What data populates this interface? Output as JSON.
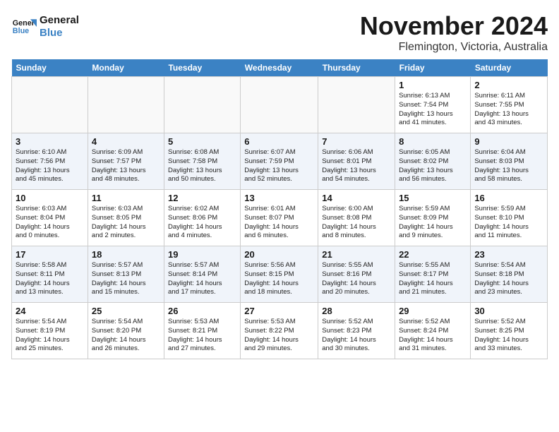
{
  "logo": {
    "line1": "General",
    "line2": "Blue"
  },
  "title": "November 2024",
  "location": "Flemington, Victoria, Australia",
  "headers": [
    "Sunday",
    "Monday",
    "Tuesday",
    "Wednesday",
    "Thursday",
    "Friday",
    "Saturday"
  ],
  "weeks": [
    [
      {
        "day": "",
        "info": ""
      },
      {
        "day": "",
        "info": ""
      },
      {
        "day": "",
        "info": ""
      },
      {
        "day": "",
        "info": ""
      },
      {
        "day": "",
        "info": ""
      },
      {
        "day": "1",
        "info": "Sunrise: 6:13 AM\nSunset: 7:54 PM\nDaylight: 13 hours\nand 41 minutes."
      },
      {
        "day": "2",
        "info": "Sunrise: 6:11 AM\nSunset: 7:55 PM\nDaylight: 13 hours\nand 43 minutes."
      }
    ],
    [
      {
        "day": "3",
        "info": "Sunrise: 6:10 AM\nSunset: 7:56 PM\nDaylight: 13 hours\nand 45 minutes."
      },
      {
        "day": "4",
        "info": "Sunrise: 6:09 AM\nSunset: 7:57 PM\nDaylight: 13 hours\nand 48 minutes."
      },
      {
        "day": "5",
        "info": "Sunrise: 6:08 AM\nSunset: 7:58 PM\nDaylight: 13 hours\nand 50 minutes."
      },
      {
        "day": "6",
        "info": "Sunrise: 6:07 AM\nSunset: 7:59 PM\nDaylight: 13 hours\nand 52 minutes."
      },
      {
        "day": "7",
        "info": "Sunrise: 6:06 AM\nSunset: 8:01 PM\nDaylight: 13 hours\nand 54 minutes."
      },
      {
        "day": "8",
        "info": "Sunrise: 6:05 AM\nSunset: 8:02 PM\nDaylight: 13 hours\nand 56 minutes."
      },
      {
        "day": "9",
        "info": "Sunrise: 6:04 AM\nSunset: 8:03 PM\nDaylight: 13 hours\nand 58 minutes."
      }
    ],
    [
      {
        "day": "10",
        "info": "Sunrise: 6:03 AM\nSunset: 8:04 PM\nDaylight: 14 hours\nand 0 minutes."
      },
      {
        "day": "11",
        "info": "Sunrise: 6:03 AM\nSunset: 8:05 PM\nDaylight: 14 hours\nand 2 minutes."
      },
      {
        "day": "12",
        "info": "Sunrise: 6:02 AM\nSunset: 8:06 PM\nDaylight: 14 hours\nand 4 minutes."
      },
      {
        "day": "13",
        "info": "Sunrise: 6:01 AM\nSunset: 8:07 PM\nDaylight: 14 hours\nand 6 minutes."
      },
      {
        "day": "14",
        "info": "Sunrise: 6:00 AM\nSunset: 8:08 PM\nDaylight: 14 hours\nand 8 minutes."
      },
      {
        "day": "15",
        "info": "Sunrise: 5:59 AM\nSunset: 8:09 PM\nDaylight: 14 hours\nand 9 minutes."
      },
      {
        "day": "16",
        "info": "Sunrise: 5:59 AM\nSunset: 8:10 PM\nDaylight: 14 hours\nand 11 minutes."
      }
    ],
    [
      {
        "day": "17",
        "info": "Sunrise: 5:58 AM\nSunset: 8:11 PM\nDaylight: 14 hours\nand 13 minutes."
      },
      {
        "day": "18",
        "info": "Sunrise: 5:57 AM\nSunset: 8:13 PM\nDaylight: 14 hours\nand 15 minutes."
      },
      {
        "day": "19",
        "info": "Sunrise: 5:57 AM\nSunset: 8:14 PM\nDaylight: 14 hours\nand 17 minutes."
      },
      {
        "day": "20",
        "info": "Sunrise: 5:56 AM\nSunset: 8:15 PM\nDaylight: 14 hours\nand 18 minutes."
      },
      {
        "day": "21",
        "info": "Sunrise: 5:55 AM\nSunset: 8:16 PM\nDaylight: 14 hours\nand 20 minutes."
      },
      {
        "day": "22",
        "info": "Sunrise: 5:55 AM\nSunset: 8:17 PM\nDaylight: 14 hours\nand 21 minutes."
      },
      {
        "day": "23",
        "info": "Sunrise: 5:54 AM\nSunset: 8:18 PM\nDaylight: 14 hours\nand 23 minutes."
      }
    ],
    [
      {
        "day": "24",
        "info": "Sunrise: 5:54 AM\nSunset: 8:19 PM\nDaylight: 14 hours\nand 25 minutes."
      },
      {
        "day": "25",
        "info": "Sunrise: 5:54 AM\nSunset: 8:20 PM\nDaylight: 14 hours\nand 26 minutes."
      },
      {
        "day": "26",
        "info": "Sunrise: 5:53 AM\nSunset: 8:21 PM\nDaylight: 14 hours\nand 27 minutes."
      },
      {
        "day": "27",
        "info": "Sunrise: 5:53 AM\nSunset: 8:22 PM\nDaylight: 14 hours\nand 29 minutes."
      },
      {
        "day": "28",
        "info": "Sunrise: 5:52 AM\nSunset: 8:23 PM\nDaylight: 14 hours\nand 30 minutes."
      },
      {
        "day": "29",
        "info": "Sunrise: 5:52 AM\nSunset: 8:24 PM\nDaylight: 14 hours\nand 31 minutes."
      },
      {
        "day": "30",
        "info": "Sunrise: 5:52 AM\nSunset: 8:25 PM\nDaylight: 14 hours\nand 33 minutes."
      }
    ]
  ]
}
